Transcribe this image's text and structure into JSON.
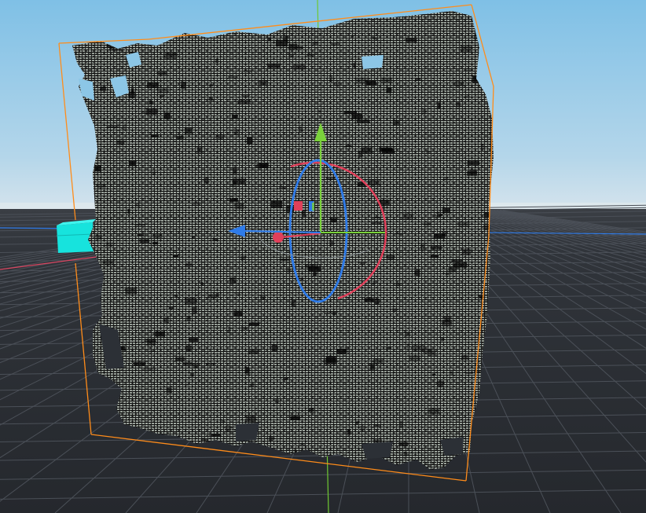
{
  "viewport": {
    "kind": "3d-editor-viewport",
    "colors": {
      "sky_top": "#8ec8e8",
      "sky_horizon": "#c9dde8",
      "ground": "#2c3036",
      "grid_line": "#4a4f57",
      "x_axis": "#e0405a",
      "y_axis": "#7ad13b",
      "z_axis": "#2f7be8",
      "selection_box": "#ff8c1a",
      "mesh_fill": "#8f968f",
      "mesh_wire": "#0a0a0a",
      "cyan_object": "#19e6e0"
    }
  },
  "selected_object": {
    "icon": "point-cloud-mesh",
    "outline": "bounding-box"
  },
  "gizmo": {
    "mode": "translate-rotate",
    "handles": [
      "x-handle",
      "y-handle",
      "z-handle",
      "xy-plane-handle",
      "rotation-ring"
    ]
  }
}
